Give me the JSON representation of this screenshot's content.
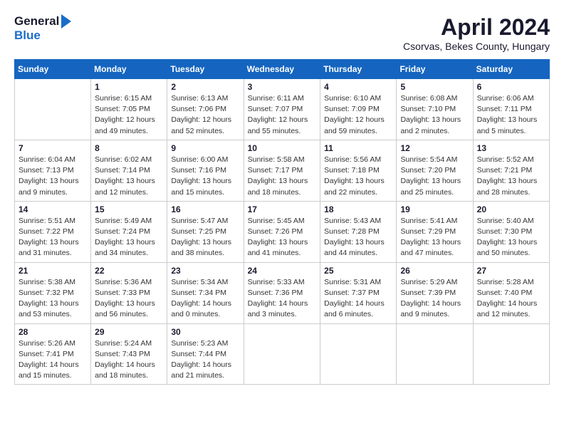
{
  "header": {
    "logo_general": "General",
    "logo_blue": "Blue",
    "month_title": "April 2024",
    "location": "Csorvas, Bekes County, Hungary"
  },
  "weekdays": [
    "Sunday",
    "Monday",
    "Tuesday",
    "Wednesday",
    "Thursday",
    "Friday",
    "Saturday"
  ],
  "weeks": [
    [
      {
        "day": "",
        "sunrise": "",
        "sunset": "",
        "daylight": ""
      },
      {
        "day": "1",
        "sunrise": "Sunrise: 6:15 AM",
        "sunset": "Sunset: 7:05 PM",
        "daylight": "Daylight: 12 hours and 49 minutes."
      },
      {
        "day": "2",
        "sunrise": "Sunrise: 6:13 AM",
        "sunset": "Sunset: 7:06 PM",
        "daylight": "Daylight: 12 hours and 52 minutes."
      },
      {
        "day": "3",
        "sunrise": "Sunrise: 6:11 AM",
        "sunset": "Sunset: 7:07 PM",
        "daylight": "Daylight: 12 hours and 55 minutes."
      },
      {
        "day": "4",
        "sunrise": "Sunrise: 6:10 AM",
        "sunset": "Sunset: 7:09 PM",
        "daylight": "Daylight: 12 hours and 59 minutes."
      },
      {
        "day": "5",
        "sunrise": "Sunrise: 6:08 AM",
        "sunset": "Sunset: 7:10 PM",
        "daylight": "Daylight: 13 hours and 2 minutes."
      },
      {
        "day": "6",
        "sunrise": "Sunrise: 6:06 AM",
        "sunset": "Sunset: 7:11 PM",
        "daylight": "Daylight: 13 hours and 5 minutes."
      }
    ],
    [
      {
        "day": "7",
        "sunrise": "Sunrise: 6:04 AM",
        "sunset": "Sunset: 7:13 PM",
        "daylight": "Daylight: 13 hours and 9 minutes."
      },
      {
        "day": "8",
        "sunrise": "Sunrise: 6:02 AM",
        "sunset": "Sunset: 7:14 PM",
        "daylight": "Daylight: 13 hours and 12 minutes."
      },
      {
        "day": "9",
        "sunrise": "Sunrise: 6:00 AM",
        "sunset": "Sunset: 7:16 PM",
        "daylight": "Daylight: 13 hours and 15 minutes."
      },
      {
        "day": "10",
        "sunrise": "Sunrise: 5:58 AM",
        "sunset": "Sunset: 7:17 PM",
        "daylight": "Daylight: 13 hours and 18 minutes."
      },
      {
        "day": "11",
        "sunrise": "Sunrise: 5:56 AM",
        "sunset": "Sunset: 7:18 PM",
        "daylight": "Daylight: 13 hours and 22 minutes."
      },
      {
        "day": "12",
        "sunrise": "Sunrise: 5:54 AM",
        "sunset": "Sunset: 7:20 PM",
        "daylight": "Daylight: 13 hours and 25 minutes."
      },
      {
        "day": "13",
        "sunrise": "Sunrise: 5:52 AM",
        "sunset": "Sunset: 7:21 PM",
        "daylight": "Daylight: 13 hours and 28 minutes."
      }
    ],
    [
      {
        "day": "14",
        "sunrise": "Sunrise: 5:51 AM",
        "sunset": "Sunset: 7:22 PM",
        "daylight": "Daylight: 13 hours and 31 minutes."
      },
      {
        "day": "15",
        "sunrise": "Sunrise: 5:49 AM",
        "sunset": "Sunset: 7:24 PM",
        "daylight": "Daylight: 13 hours and 34 minutes."
      },
      {
        "day": "16",
        "sunrise": "Sunrise: 5:47 AM",
        "sunset": "Sunset: 7:25 PM",
        "daylight": "Daylight: 13 hours and 38 minutes."
      },
      {
        "day": "17",
        "sunrise": "Sunrise: 5:45 AM",
        "sunset": "Sunset: 7:26 PM",
        "daylight": "Daylight: 13 hours and 41 minutes."
      },
      {
        "day": "18",
        "sunrise": "Sunrise: 5:43 AM",
        "sunset": "Sunset: 7:28 PM",
        "daylight": "Daylight: 13 hours and 44 minutes."
      },
      {
        "day": "19",
        "sunrise": "Sunrise: 5:41 AM",
        "sunset": "Sunset: 7:29 PM",
        "daylight": "Daylight: 13 hours and 47 minutes."
      },
      {
        "day": "20",
        "sunrise": "Sunrise: 5:40 AM",
        "sunset": "Sunset: 7:30 PM",
        "daylight": "Daylight: 13 hours and 50 minutes."
      }
    ],
    [
      {
        "day": "21",
        "sunrise": "Sunrise: 5:38 AM",
        "sunset": "Sunset: 7:32 PM",
        "daylight": "Daylight: 13 hours and 53 minutes."
      },
      {
        "day": "22",
        "sunrise": "Sunrise: 5:36 AM",
        "sunset": "Sunset: 7:33 PM",
        "daylight": "Daylight: 13 hours and 56 minutes."
      },
      {
        "day": "23",
        "sunrise": "Sunrise: 5:34 AM",
        "sunset": "Sunset: 7:34 PM",
        "daylight": "Daylight: 14 hours and 0 minutes."
      },
      {
        "day": "24",
        "sunrise": "Sunrise: 5:33 AM",
        "sunset": "Sunset: 7:36 PM",
        "daylight": "Daylight: 14 hours and 3 minutes."
      },
      {
        "day": "25",
        "sunrise": "Sunrise: 5:31 AM",
        "sunset": "Sunset: 7:37 PM",
        "daylight": "Daylight: 14 hours and 6 minutes."
      },
      {
        "day": "26",
        "sunrise": "Sunrise: 5:29 AM",
        "sunset": "Sunset: 7:39 PM",
        "daylight": "Daylight: 14 hours and 9 minutes."
      },
      {
        "day": "27",
        "sunrise": "Sunrise: 5:28 AM",
        "sunset": "Sunset: 7:40 PM",
        "daylight": "Daylight: 14 hours and 12 minutes."
      }
    ],
    [
      {
        "day": "28",
        "sunrise": "Sunrise: 5:26 AM",
        "sunset": "Sunset: 7:41 PM",
        "daylight": "Daylight: 14 hours and 15 minutes."
      },
      {
        "day": "29",
        "sunrise": "Sunrise: 5:24 AM",
        "sunset": "Sunset: 7:43 PM",
        "daylight": "Daylight: 14 hours and 18 minutes."
      },
      {
        "day": "30",
        "sunrise": "Sunrise: 5:23 AM",
        "sunset": "Sunset: 7:44 PM",
        "daylight": "Daylight: 14 hours and 21 minutes."
      },
      {
        "day": "",
        "sunrise": "",
        "sunset": "",
        "daylight": ""
      },
      {
        "day": "",
        "sunrise": "",
        "sunset": "",
        "daylight": ""
      },
      {
        "day": "",
        "sunrise": "",
        "sunset": "",
        "daylight": ""
      },
      {
        "day": "",
        "sunrise": "",
        "sunset": "",
        "daylight": ""
      }
    ]
  ]
}
